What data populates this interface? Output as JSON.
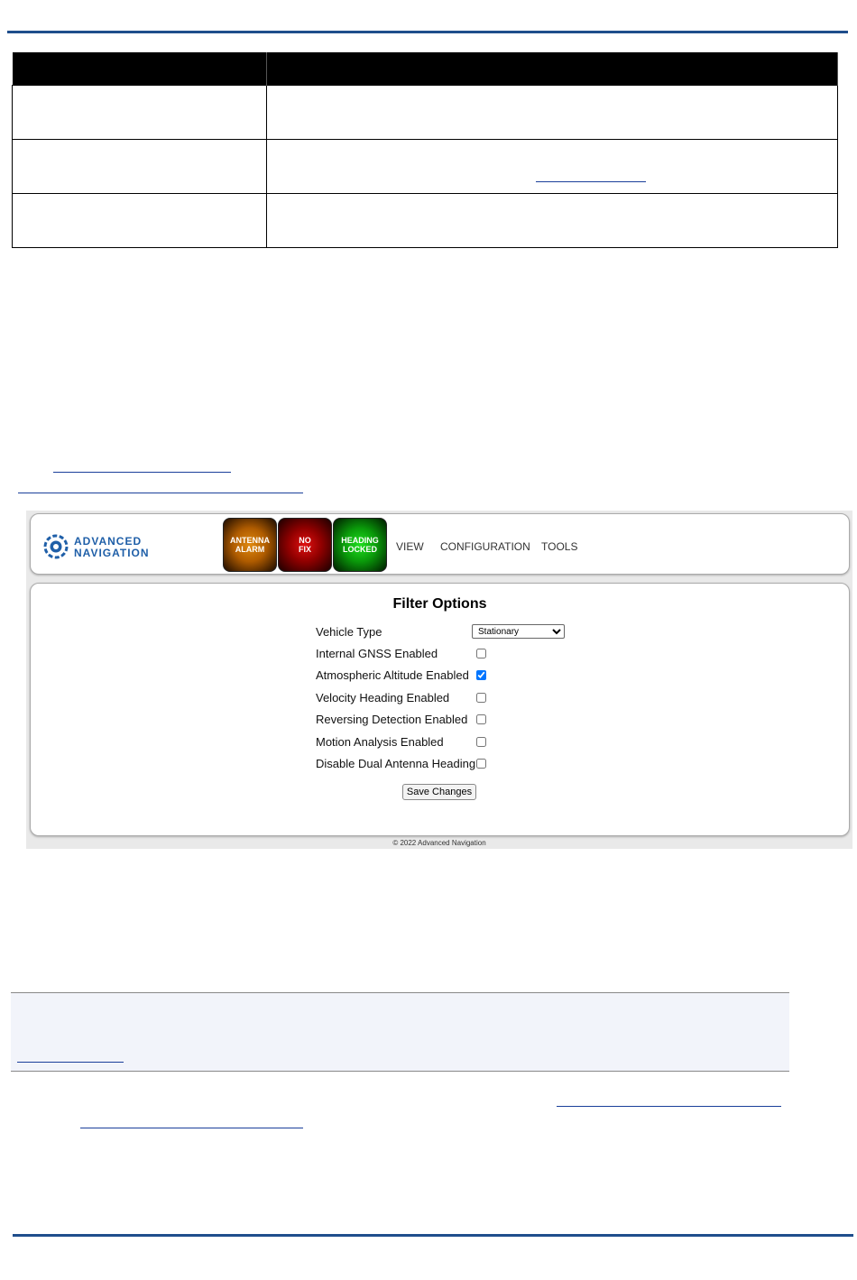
{
  "webui": {
    "logo": {
      "line1": "ADVANCED",
      "line2": "NAVIGATION"
    },
    "status": [
      {
        "line1": "ANTENNA",
        "line2": "ALARM",
        "color": "#b05c00"
      },
      {
        "line1": "NO",
        "line2": "FIX",
        "color": "#900000"
      },
      {
        "line1": "HEADING",
        "line2": "LOCKED",
        "color": "#0a9a0a"
      }
    ],
    "nav": {
      "view": "VIEW",
      "configuration": "CONFIGURATION",
      "tools": "TOOLS"
    },
    "filter": {
      "title": "Filter Options",
      "vehicle_type_label": "Vehicle Type",
      "vehicle_type_value": "Stationary",
      "options": [
        {
          "label": "Internal GNSS Enabled",
          "checked": false
        },
        {
          "label": "Atmospheric Altitude Enabled",
          "checked": true
        },
        {
          "label": "Velocity Heading Enabled",
          "checked": false
        },
        {
          "label": "Reversing Detection Enabled",
          "checked": false
        },
        {
          "label": "Motion Analysis Enabled",
          "checked": false
        },
        {
          "label": "Disable Dual Antenna Heading",
          "checked": false
        }
      ],
      "save_label": "Save Changes"
    },
    "footer": "© 2022 Advanced Navigation"
  },
  "colors": {
    "rule": "#1f4e8c",
    "link": "#1a3f9a",
    "logo": "#1f5fa8"
  }
}
